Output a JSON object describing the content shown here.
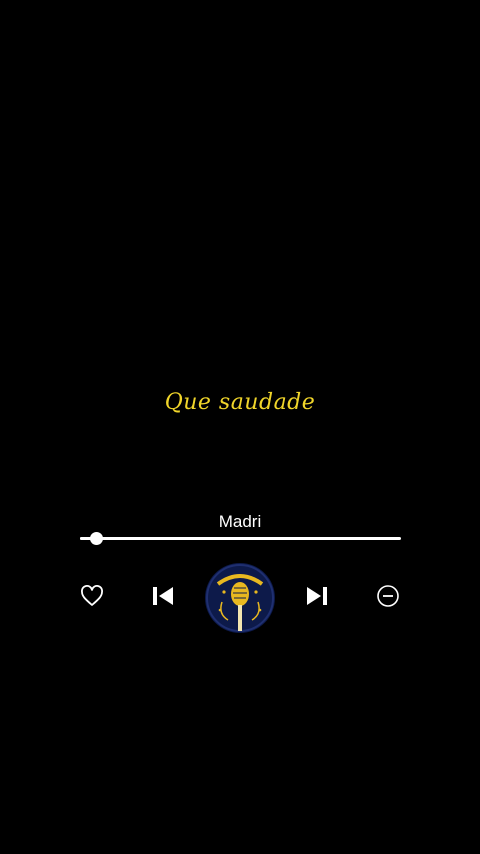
{
  "lyric": {
    "text": "Que saudade",
    "color": "#f0d52a"
  },
  "player": {
    "track_title": "Madri",
    "progress_fraction": 0.05,
    "controls": {
      "like_icon": "heart-outline-icon",
      "prev_icon": "skip-previous-icon",
      "next_icon": "skip-next-icon",
      "remove_icon": "minus-circle-icon"
    },
    "cover": {
      "icon": "microphone-logo-icon",
      "colors": {
        "background": "#0d1a4a",
        "accent": "#e8b820"
      }
    }
  },
  "colors": {
    "background": "#000000",
    "text": "#ffffff"
  }
}
